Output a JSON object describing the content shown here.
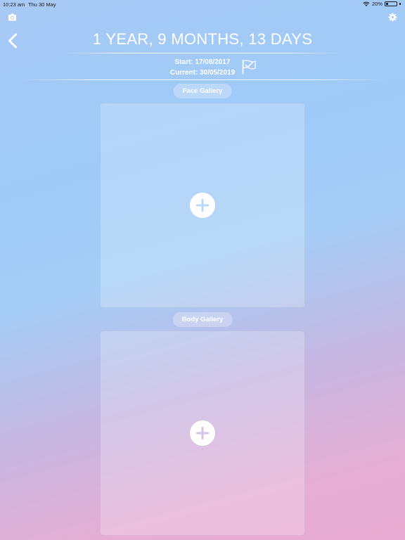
{
  "status_bar": {
    "time": "10:23 am",
    "date": "Thu 30 May",
    "battery": "20%",
    "battery_level": 0.2
  },
  "header": {
    "title": "1 YEAR, 9 MONTHS, 13 DAYS",
    "start": "Start: 17/08/2017",
    "current": "Current: 30/05/2019"
  },
  "face_gallery": {
    "label": "Face Gallery",
    "plus_color": "#b9d9fb"
  },
  "body_gallery": {
    "label": "Body Gallery",
    "plus_color": "#d6c2e2"
  },
  "icons": {
    "camera": "camera-icon",
    "settings": "gear-icon",
    "back": "chevron-left-icon",
    "flag": "checkered-flag-icon",
    "add": "plus-icon"
  }
}
